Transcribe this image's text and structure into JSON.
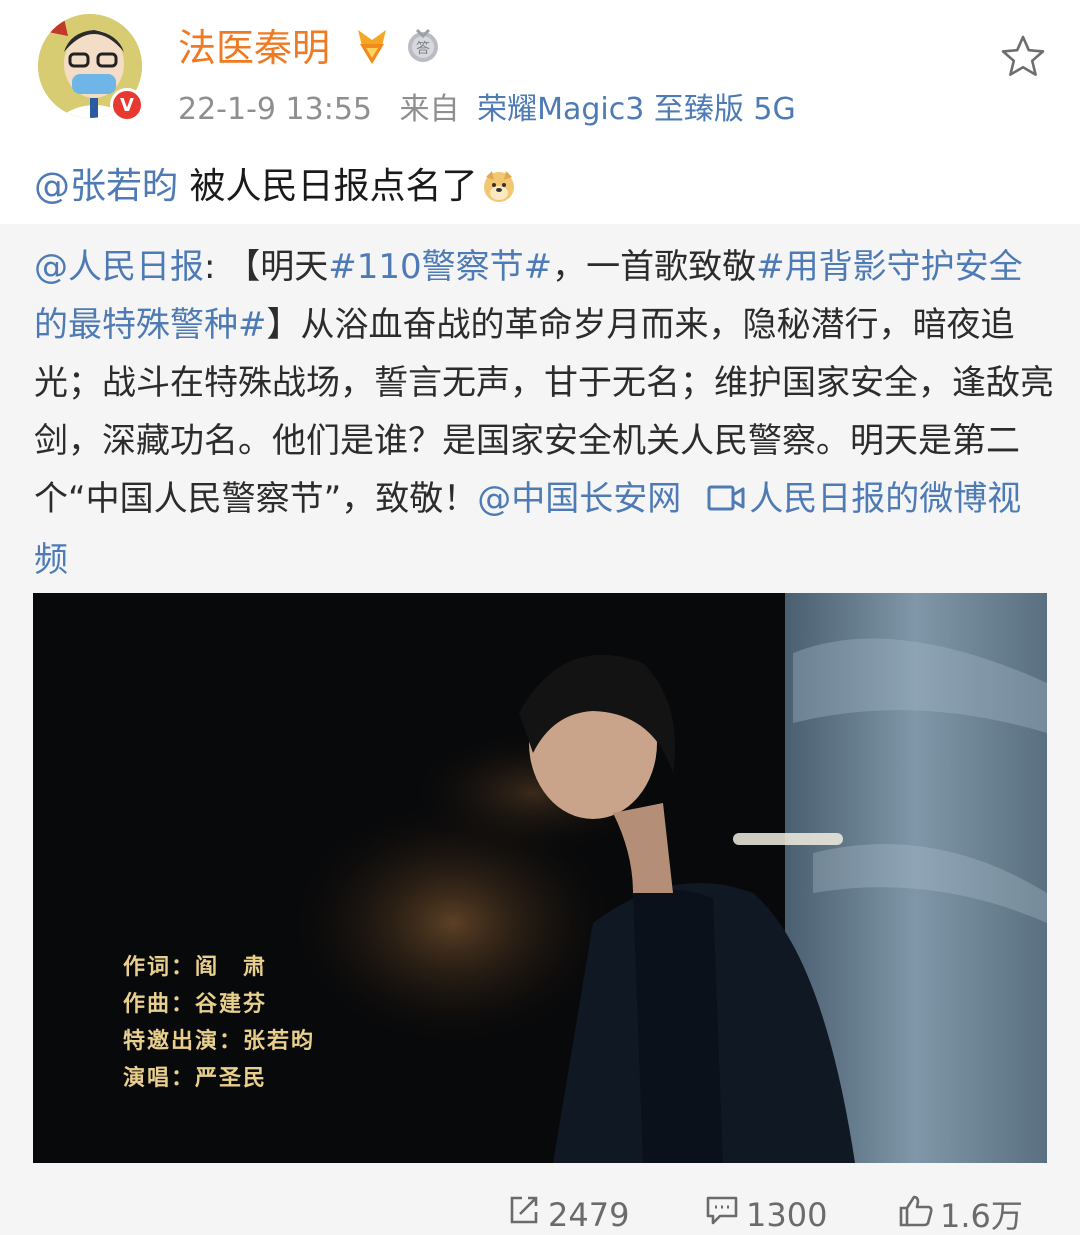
{
  "header": {
    "username": "法医秦明",
    "timestamp": "22-1-9 13:55",
    "from_label": "来自",
    "source": "荣耀Magic3 至臻版 5G",
    "verified_icon": "v-badge",
    "badge_text": "答"
  },
  "post": {
    "mention": "@张若昀",
    "text": " 被人民日报点名了",
    "emoji": "doge-emoji"
  },
  "repost": {
    "author": "@人民日报",
    "colon": ": ",
    "bracket_open": "【明天",
    "tag1": "#110警察节#",
    "mid1": "，一首歌致敬",
    "tag2": "#用背影守护安全的最特殊警种#",
    "body": "】从浴血奋战的革命岁月而来，隐秘潜行，暗夜追光；战斗在特殊战场，誓言无声，甘于无名；维护国家安全，逢敌亮剑，深藏功名。他们是谁？是国家安全机关人民警察。明天是第二个“中国人民警察节”，致敬！",
    "mention2": "@中国长安网",
    "video_link": "人民日报的微博视频"
  },
  "video": {
    "credits": [
      "作词：阎　肃",
      "作曲：谷建芬",
      "特邀出演：张若昀",
      "演唱：严圣民"
    ]
  },
  "actions": {
    "repost_count": "2479",
    "comment_count": "1300",
    "like_count": "1.6万"
  },
  "colors": {
    "username": "#f07a23",
    "link": "#4e7bb5",
    "meta": "#8f8f8f",
    "repost_bg": "#f5f5f5"
  }
}
